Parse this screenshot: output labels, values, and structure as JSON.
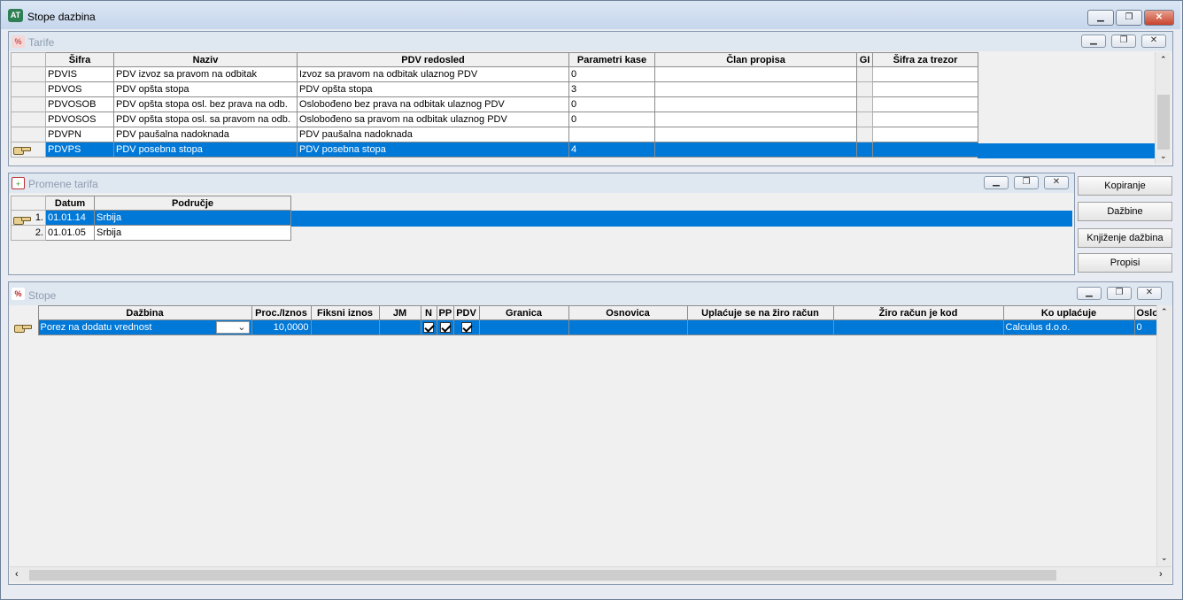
{
  "window": {
    "title": "Stope dazbina"
  },
  "tarife": {
    "title": "Tarife",
    "columns": [
      "Šifra",
      "Naziv",
      "PDV redosled",
      "Parametri kase",
      "Član propisa",
      "GI",
      "Šifra za trezor"
    ],
    "rows": [
      [
        "PDVIS",
        "PDV izvoz sa pravom na odbitak",
        "Izvoz sa pravom na odbitak ulaznog PDV",
        "0",
        "",
        "",
        ""
      ],
      [
        "PDVOS",
        "PDV opšta stopa",
        "PDV opšta stopa",
        "3",
        "",
        "",
        ""
      ],
      [
        "PDVOSOB",
        "PDV opšta stopa osl. bez prava na odb.",
        "Oslobođeno bez prava na odbitak ulaznog PDV",
        "0",
        "",
        "",
        ""
      ],
      [
        "PDVOSOS",
        "PDV opšta stopa osl. sa pravom na odb.",
        "Oslobođeno sa pravom na odbitak ulaznog PDV",
        "0",
        "",
        "",
        ""
      ],
      [
        "PDVPN",
        "PDV paušalna nadoknada",
        "PDV paušalna nadoknada",
        "",
        "",
        "",
        ""
      ],
      [
        "PDVPS",
        "PDV posebna stopa",
        "PDV posebna stopa",
        "4",
        "",
        "",
        ""
      ]
    ]
  },
  "promene": {
    "title": "Promene tarifa",
    "columns": [
      "Datum",
      "Područje"
    ],
    "rows": [
      {
        "num": "1.",
        "datum": "01.01.14",
        "podrucje": "Srbija"
      },
      {
        "num": "2.",
        "datum": "01.01.05",
        "podrucje": "Srbija"
      }
    ]
  },
  "buttons": {
    "kopiranje": "Kopiranje",
    "dazbine": "Dažbine",
    "knjizenje": "Knjiženje dažbina",
    "propisi": "Propisi"
  },
  "stope": {
    "title": "Stope",
    "columns": [
      "Dažbina",
      "Proc./Iznos",
      "Fiksni iznos",
      "JM",
      "N",
      "PP",
      "PDV",
      "Granica",
      "Osnovica",
      "Uplaćuje se na žiro račun",
      "Žiro račun je kod",
      "Ko uplaćuje",
      "Oslob"
    ],
    "row": {
      "dazbina": "Porez na dodatu vrednost",
      "proc": "10,0000",
      "fiksni": "",
      "jm": "",
      "n": true,
      "pp": true,
      "pdv": true,
      "granica": "",
      "osnovica": "",
      "uplacuje": "",
      "ziro": "",
      "ko": "Calculus d.o.o.",
      "oslob": "0"
    }
  },
  "icons": {
    "window": "app-icon",
    "minimize": "minimize-icon",
    "restore": "restore-icon",
    "close": "close-icon"
  }
}
